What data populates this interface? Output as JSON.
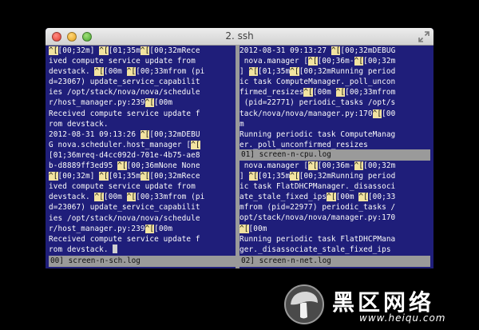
{
  "window": {
    "title": "2. ssh"
  },
  "panes": {
    "left": [
      [
        [
          "esc",
          "^["
        ],
        [
          "t",
          "[00;32m] "
        ],
        [
          "esc",
          "^["
        ],
        [
          "t",
          "[01;35m"
        ],
        [
          "esc",
          "^["
        ],
        [
          "t",
          "[00;32mRece"
        ]
      ],
      [
        [
          "t",
          "ived compute service update from"
        ]
      ],
      [
        [
          "t",
          "devstack. "
        ],
        [
          "esc",
          "^["
        ],
        [
          "t",
          "[00m "
        ],
        [
          "esc",
          "^["
        ],
        [
          "t",
          "[00;33mfrom (pi"
        ]
      ],
      [
        [
          "t",
          "d=23067) update_service_capabilit"
        ]
      ],
      [
        [
          "t",
          "ies /opt/stack/nova/nova/schedule"
        ]
      ],
      [
        [
          "t",
          "r/host_manager.py:239"
        ],
        [
          "esc",
          "^["
        ],
        [
          "t",
          "[00m"
        ]
      ],
      [
        [
          "t",
          "Received compute service update f"
        ]
      ],
      [
        [
          "t",
          "rom devstack."
        ]
      ],
      [
        [
          "t",
          "2012-08-31 09:13:26 "
        ],
        [
          "esc",
          "^["
        ],
        [
          "t",
          "[00;32mDEBU"
        ]
      ],
      [
        [
          "t",
          "G nova.scheduler.host_manager ["
        ],
        [
          "esc",
          "^["
        ]
      ],
      [
        [
          "t",
          "[01;36mreq-d4cc092d-701e-4b75-ae8"
        ]
      ],
      [
        [
          "t",
          "b-d8889ff3ed95 "
        ],
        [
          "esc",
          "^["
        ],
        [
          "t",
          "[00;36mNone None"
        ]
      ],
      [
        [
          "esc",
          "^["
        ],
        [
          "t",
          "[00;32m] "
        ],
        [
          "esc",
          "^["
        ],
        [
          "t",
          "[01;35m"
        ],
        [
          "esc",
          "^["
        ],
        [
          "t",
          "[00;32mRece"
        ]
      ],
      [
        [
          "t",
          "ived compute service update from"
        ]
      ],
      [
        [
          "t",
          "devstack. "
        ],
        [
          "esc",
          "^["
        ],
        [
          "t",
          "[00m "
        ],
        [
          "esc",
          "^["
        ],
        [
          "t",
          "[00;33mfrom (pi"
        ]
      ],
      [
        [
          "t",
          "d=23067) update_service_capabilit"
        ]
      ],
      [
        [
          "t",
          "ies /opt/stack/nova/nova/schedule"
        ]
      ],
      [
        [
          "t",
          "r/host_manager.py:239"
        ],
        [
          "esc",
          "^["
        ],
        [
          "t",
          "[00m"
        ]
      ],
      [
        [
          "t",
          "Received compute service update f"
        ]
      ],
      [
        [
          "t",
          "rom devstack. "
        ],
        [
          "cursor",
          ""
        ]
      ]
    ],
    "top_right": [
      [
        [
          "t",
          "2012-08-31 09:13:27 "
        ],
        [
          "esc",
          "^["
        ],
        [
          "t",
          "[00;32mDEBUG"
        ]
      ],
      [
        [
          "t",
          " nova.manager ["
        ],
        [
          "esc",
          "^["
        ],
        [
          "t",
          "[00;36m-"
        ],
        [
          "esc",
          "^["
        ],
        [
          "t",
          "[00;32m"
        ]
      ],
      [
        [
          "t",
          "] "
        ],
        [
          "esc",
          "^["
        ],
        [
          "t",
          "[01;35m"
        ],
        [
          "esc",
          "^["
        ],
        [
          "t",
          "[00;32mRunning period"
        ]
      ],
      [
        [
          "t",
          "ic task ComputeManager._poll_uncon"
        ]
      ],
      [
        [
          "t",
          "firmed_resizes"
        ],
        [
          "esc",
          "^["
        ],
        [
          "t",
          "[00m "
        ],
        [
          "esc",
          "^["
        ],
        [
          "t",
          "[00;33mfrom"
        ]
      ],
      [
        [
          "t",
          " (pid=22771) periodic_tasks /opt/s"
        ]
      ],
      [
        [
          "t",
          "tack/nova/nova/manager.py:170"
        ],
        [
          "esc",
          "^["
        ],
        [
          "t",
          "[00"
        ]
      ],
      [
        [
          "t",
          "m"
        ]
      ],
      [
        [
          "t",
          "Running periodic task ComputeManag"
        ]
      ],
      [
        [
          "t",
          "er._poll_unconfirmed_resizes"
        ]
      ]
    ],
    "bottom_right": [
      [
        [
          "t",
          " nova.manager ["
        ],
        [
          "esc",
          "^["
        ],
        [
          "t",
          "[00;36m-"
        ],
        [
          "esc",
          "^["
        ],
        [
          "t",
          "[00;32m"
        ]
      ],
      [
        [
          "t",
          "] "
        ],
        [
          "esc",
          "^["
        ],
        [
          "t",
          "[01;35m"
        ],
        [
          "esc",
          "^["
        ],
        [
          "t",
          "[00;32mRunning period"
        ]
      ],
      [
        [
          "t",
          "ic task FlatDHCPManager._disassoci"
        ]
      ],
      [
        [
          "t",
          "ate_stale_fixed_ips"
        ],
        [
          "esc",
          "^["
        ],
        [
          "t",
          "[00m "
        ],
        [
          "esc",
          "^["
        ],
        [
          "t",
          "[00;33"
        ]
      ],
      [
        [
          "t",
          "mfrom (pid=22977) periodic_tasks /"
        ]
      ],
      [
        [
          "t",
          "opt/stack/nova/nova/manager.py:170"
        ]
      ],
      [
        [
          "esc",
          "^["
        ],
        [
          "t",
          "[00m"
        ]
      ],
      [
        [
          "t",
          "Running periodic task FlatDHCPMana"
        ]
      ],
      [
        [
          "t",
          "ger._disassociate_stale_fixed_ips"
        ]
      ]
    ]
  },
  "status": {
    "left": "00] screen-n-sch.log",
    "top_right": "01] screen-n-cpu.log",
    "bottom_right": "02] screen-n-net.log"
  },
  "watermark": {
    "chinese": "黑区网络",
    "url": "www.heiqu.com"
  },
  "colors": {
    "terminal_bg": "#1f1e7a",
    "escape_highlight": "#f2e3a0",
    "status_bar": "#9a9a9a"
  }
}
